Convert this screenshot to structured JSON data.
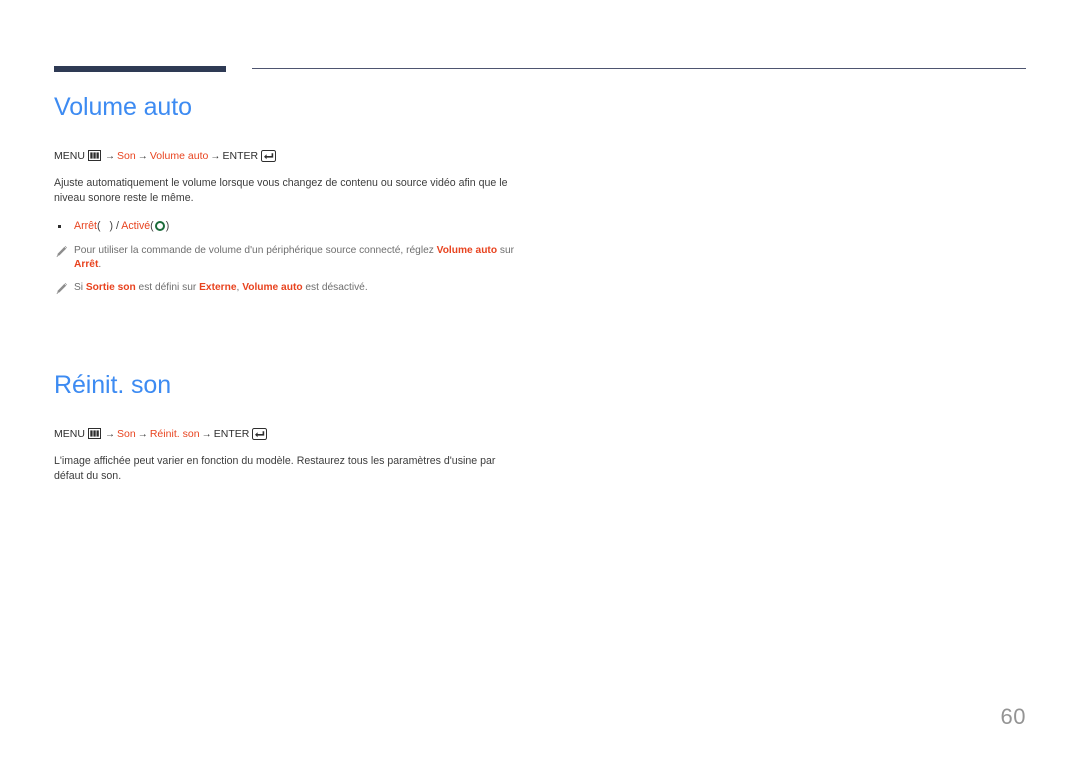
{
  "page": {
    "number": "60",
    "language": "fr"
  },
  "theme": {
    "heading_color": "#3d8bf2",
    "accent_color": "#e8431f",
    "rule_dark_color": "#2e3a54",
    "rule_thin_color": "#4e5570",
    "body_text_color": "#3d3d3d",
    "note_text_color": "#6e6e6e",
    "ring_glyph_color": "#1b6b3a",
    "page_number_color": "#949494"
  },
  "sections": [
    {
      "title": "Volume auto",
      "menu_path": {
        "menu_label": "MENU",
        "menu_icon": "menu-icon",
        "arrow": "→",
        "step1": "Son",
        "step2": "Volume auto",
        "enter_label": "ENTER",
        "enter_icon": "enter-key-icon"
      },
      "description": "Ajuste automatiquement le volume lorsque vous changez de contenu ou source vidéo afin que le niveau sonore reste le même.",
      "options": {
        "off_label": "Arrêt",
        "off_glyph": "blank-glyph",
        "separator": "/",
        "on_label": "Activé",
        "on_glyph": "green-ring-icon",
        "paren_open": "(",
        "paren_close": ")"
      },
      "notes": [
        {
          "icon": "pencil-note-icon",
          "parts": [
            {
              "text": "Pour utiliser la commande de volume d'un périphérique source connecté, réglez ",
              "accent": false
            },
            {
              "text": "Volume auto",
              "accent": true
            },
            {
              "text": " sur ",
              "accent": false
            },
            {
              "text": "Arrêt",
              "accent": true
            },
            {
              "text": ".",
              "accent": false
            }
          ]
        },
        {
          "icon": "pencil-note-icon",
          "parts": [
            {
              "text": "Si ",
              "accent": false
            },
            {
              "text": "Sortie son",
              "accent": true
            },
            {
              "text": " est défini sur ",
              "accent": false
            },
            {
              "text": "Externe",
              "accent": true
            },
            {
              "text": ", ",
              "accent": false
            },
            {
              "text": "Volume auto",
              "accent": true
            },
            {
              "text": " est désactivé.",
              "accent": false
            }
          ]
        }
      ]
    },
    {
      "title": "Réinit. son",
      "menu_path": {
        "menu_label": "MENU",
        "menu_icon": "menu-icon",
        "arrow": "→",
        "step1": "Son",
        "step2": "Réinit. son",
        "enter_label": "ENTER",
        "enter_icon": "enter-key-icon"
      },
      "description": "L'image affichée peut varier en fonction du modèle. Restaurez tous les paramètres d'usine par défaut du son.",
      "options": null,
      "notes": []
    }
  ]
}
